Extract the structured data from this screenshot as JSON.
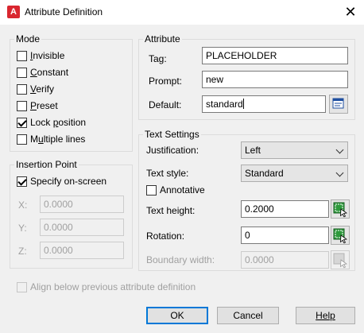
{
  "window": {
    "title": "Attribute Definition",
    "app_icon_letter": "A",
    "close_glyph": "✕"
  },
  "mode": {
    "group_label": "Mode",
    "items": [
      {
        "label": "Invisible",
        "mnemonic": "I",
        "rest": "nvisible",
        "checked": false
      },
      {
        "label": "Constant",
        "mnemonic": "C",
        "rest": "onstant",
        "checked": false
      },
      {
        "label": "Verify",
        "mnemonic": "V",
        "rest": "erify",
        "checked": false
      },
      {
        "label": "Preset",
        "mnemonic": "P",
        "rest": "reset",
        "checked": false
      },
      {
        "label": "Lock position",
        "pre": "Lock ",
        "mnemonic": "p",
        "rest": "osition",
        "checked": true
      },
      {
        "label": "Multiple lines",
        "pre": "M",
        "mnemonic": "u",
        "rest": "ltiple lines",
        "checked": false
      }
    ]
  },
  "attribute": {
    "group_label": "Attribute",
    "tag_label": "Tag:",
    "tag_value": "PLACEHOLDER",
    "prompt_label": "Prompt:",
    "prompt_value": "new",
    "default_label": "Default:",
    "default_value": "standard"
  },
  "insertion_point": {
    "group_label": "Insertion Point",
    "specify_label": "Specify on-screen",
    "specify_checked": true,
    "x_label": "X:",
    "x_value": "0.0000",
    "y_label": "Y:",
    "y_value": "0.0000",
    "z_label": "Z:",
    "z_value": "0.0000"
  },
  "text_settings": {
    "group_label": "Text Settings",
    "justification_label": "Justification:",
    "justification_value": "Left",
    "text_style_label": "Text style:",
    "text_style_value": "Standard",
    "annotative_label": "Annotative",
    "annotative_checked": false,
    "text_height_label": "Text height:",
    "text_height_value": "0.2000",
    "rotation_label": "Rotation:",
    "rotation_value": "0",
    "boundary_width_label": "Boundary width:",
    "boundary_width_value": "0.0000"
  },
  "align_below": {
    "label": "Align below previous attribute definition",
    "checked": false
  },
  "buttons": {
    "ok": "OK",
    "cancel": "Cancel",
    "help": "Help"
  },
  "colors": {
    "app_icon": "#d9262f",
    "default_button_border": "#0078d7"
  }
}
